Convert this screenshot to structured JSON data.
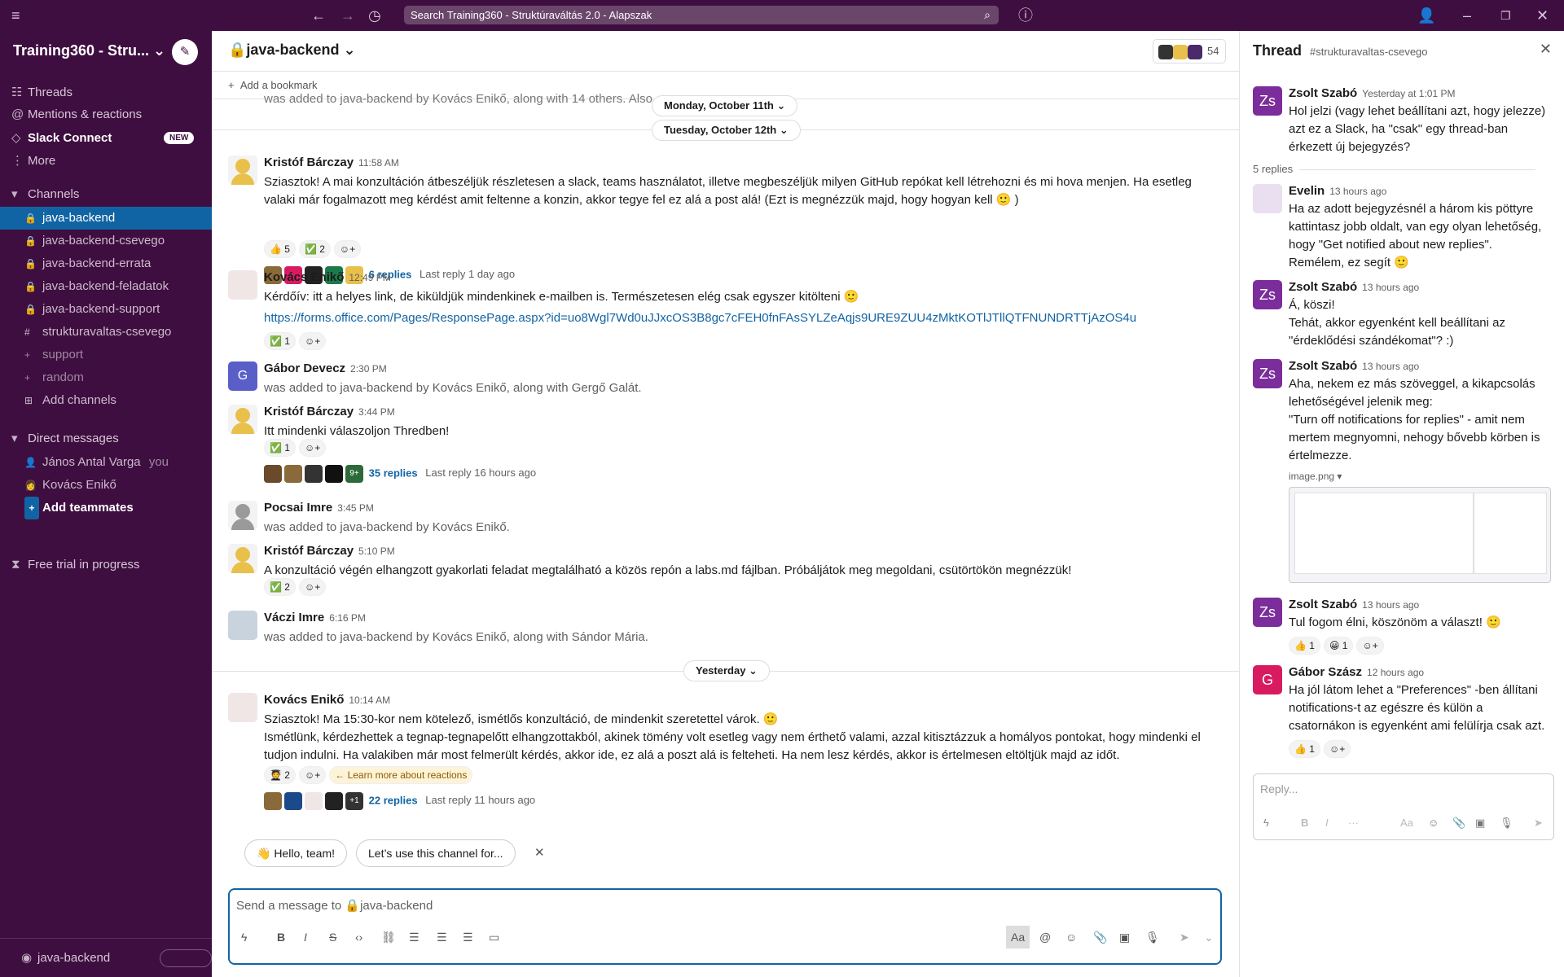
{
  "search": {
    "text": "Search Training360 - Struktúraváltás 2.0 - Alapszak"
  },
  "sidebar": {
    "workspace": "Training360 - Stru...",
    "nav": [
      {
        "label": "Threads",
        "icon": "threads-icon"
      },
      {
        "label": "Mentions & reactions",
        "icon": "at-icon"
      },
      {
        "label": "Slack Connect",
        "icon": "connect-icon"
      },
      {
        "label": "More",
        "icon": "more-icon"
      }
    ],
    "new_badge": "NEW",
    "channels_header": "Channels",
    "channels": [
      "java-backend",
      "java-backend-csevego",
      "java-backend-errata",
      "java-backend-feladatok",
      "java-backend-support",
      "strukturavaltas-csevego",
      "support",
      "random",
      "Add channels"
    ],
    "dm_header": "Direct messages",
    "dms": [
      {
        "name": "János Antal Varga",
        "suffix": "you"
      },
      {
        "name": "Kovács Enikő",
        "suffix": ""
      }
    ],
    "add_teammates": "Add teammates",
    "trial": "Free trial in progress",
    "footer_channel": "java-backend"
  },
  "channel": {
    "title": "java-backend",
    "member_count": "54",
    "bookmark": "Add a bookmark",
    "date_pills": [
      "Monday, October 11th",
      "Tuesday, October 12th",
      "Yesterday"
    ],
    "faded_text": "was added to java-backend by Kovács Enikő, along with 14 others. Also, ...",
    "messages": [
      {
        "name": "Kristóf Bárczay",
        "time": "11:58 AM",
        "text": "Sziasztok! A mai konzultáción átbeszéljük részletesen a slack, teams használatot, illetve megbeszéljük milyen GitHub repókat kell létrehozni és mi hova menjen. Ha esetleg valaki már fogalmazott meg kérdést amit feltenne a konzin, akkor tegye fel ez alá a post alá! (Ezt is megnézzük majd, hogy hogyan kell 🙂 )",
        "reactions": [
          "👍 5",
          "✅ 2"
        ],
        "replies": "6 replies",
        "last_reply": "Last reply 1 day ago"
      },
      {
        "name": "Kovács Enikő",
        "time": "12:49 PM",
        "text": "Kérdőív: itt a helyes link, de kiküldjük mindenkinek e-mailben is. Természetesen elég csak egyszer kitölteni 🙂",
        "link": "https://forms.office.com/Pages/ResponsePage.aspx?id=uo8Wgl7Wd0uJJxcOS3B8gc7cFEH0fnFAsSYLZeAqjs9URE9ZUU4zMktKOTlJTllQTFNUNDRTTjAzOS4u",
        "reactions": [
          "✅ 1"
        ]
      },
      {
        "name": "Gábor Devecz",
        "time": "2:30 PM",
        "text": "was added to java-backend by Kovács Enikő, along with Gergő Galát."
      },
      {
        "name": "Kristóf Bárczay",
        "time": "3:44 PM",
        "text": "Itt mindenki válaszoljon Thredben!",
        "reactions": [
          "✅ 1"
        ],
        "replies": "35 replies",
        "last_reply": "Last reply 16 hours ago",
        "more": "9+"
      },
      {
        "name": "Pocsai Imre",
        "time": "3:45 PM",
        "text": "was added to java-backend by Kovács Enikő."
      },
      {
        "name": "Kristóf Bárczay",
        "time": "5:10 PM",
        "text": "A konzultáció végén elhangzott gyakorlati feladat megtalálható a közös repón a labs.md fájlban. Próbáljátok meg megoldani, csütörtökön megnézzük!",
        "reactions": [
          "✅ 2"
        ]
      },
      {
        "name": "Váczi Imre",
        "time": "6:16 PM",
        "text": "was added to java-backend by Kovács Enikő, along with Sándor Mária."
      },
      {
        "name": "Kovács Enikő",
        "time": "10:14 AM",
        "text": "Sziasztok! Ma 15:30-kor nem kötelező, ismétlős konzultáció, de mindenkit szeretettel várok. 🙂\nIsmétlünk, kérdezhettek a tegnap-tegnapelőtt elhangzottakból, akinek tömény volt esetleg vagy nem érthető valami, azzal kitisztázzuk a homályos pontokat, hogy mindenki el tudjon indulni. Ha valakiben már most felmerült kérdés, akkor ide, ez  alá a poszt alá is felteheti. Ha nem lesz kérdés, akkor is értelmesen eltöltjük majd az időt.",
        "reactions": [
          "🧑‍🎓 2"
        ],
        "learn_more": "Learn more about reactions",
        "replies": "22 replies",
        "last_reply": "Last reply 11 hours ago",
        "more": "+1"
      }
    ],
    "suggestions": [
      "👋  Hello, team!",
      "Let’s use this channel for..."
    ],
    "composer_placeholder": "Send a message to 🔒java-backend"
  },
  "thread": {
    "title": "Thread",
    "channel": "#strukturavaltas-csevego",
    "replies_count": "5 replies",
    "reply_placeholder": "Reply...",
    "image_name": "image.png",
    "messages": [
      {
        "name": "Zsolt Szabó",
        "initials": "Zs",
        "time": "Yesterday at 1:01 PM",
        "text": "Hol jelzi (vagy lehet beállítani azt, hogy jelezze) azt ez a Slack, ha \"csak\" egy thread-ban érkezett új bejegyzés?"
      },
      {
        "name": "Evelin",
        "time": "13 hours ago",
        "text": "Ha az adott bejegyzésnél a három kis pöttyre kattintasz jobb oldalt, van egy olyan lehetőség, hogy \"Get notified about new replies\". Remélem, ez segít 🙂"
      },
      {
        "name": "Zsolt Szabó",
        "initials": "Zs",
        "time": "13 hours ago",
        "text": "Á, köszi!\nTehát, akkor egyenként kell beállítani az \"érdeklődési szándékomat\"? :)"
      },
      {
        "name": "Zsolt Szabó",
        "initials": "Zs",
        "time": "13 hours ago",
        "text": "Aha, nekem ez más szöveggel, a kikapcsolás lehetőségével jelenik meg:\n\"Turn off notifications for replies\" - amit nem mertem megnyomni, nehogy bővebb körben is értelmezze."
      },
      {
        "name": "Zsolt Szabó",
        "initials": "Zs",
        "time": "13 hours ago",
        "text": "Tul fogom élni, köszönöm a választ! 🙂",
        "reactions": [
          "👍 1",
          "😀 1"
        ]
      },
      {
        "name": "Gábor Szász",
        "initials": "G",
        "time": "12 hours ago",
        "text": "Ha jól látom lehet a \"Preferences\" -ben állítani notifications-t az egészre és külön a csatornákon is egyenként ami felülírja csak azt.",
        "reactions": [
          "👍 1"
        ]
      }
    ]
  },
  "colors": {
    "sidebar": "#3f0e40",
    "active": "#1164a3",
    "link": "#1264a3"
  }
}
